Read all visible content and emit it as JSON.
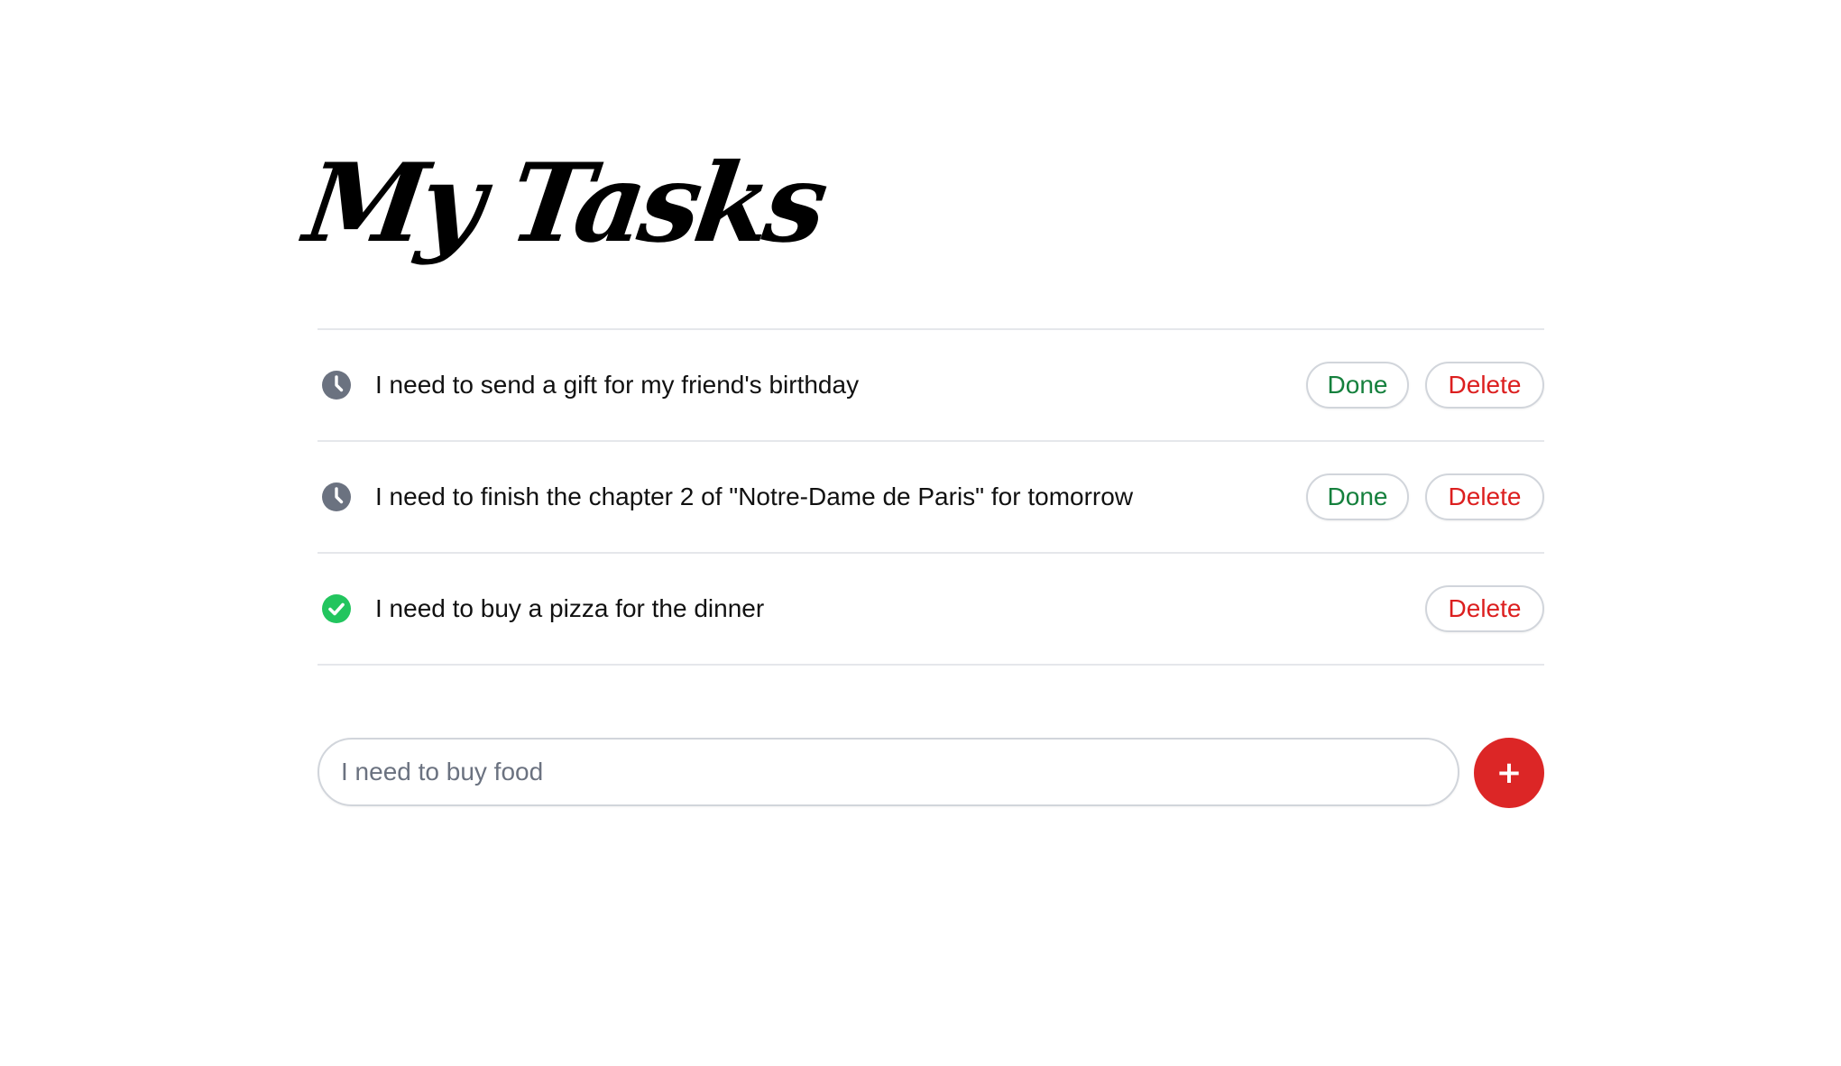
{
  "page": {
    "title": "My Tasks"
  },
  "tasks": [
    {
      "text": "I need to send a gift for my friend's birthday",
      "status": "pending",
      "status_icon": "clock-icon",
      "done_label": "Done",
      "delete_label": "Delete"
    },
    {
      "text": "I need to finish the chapter 2 of \"Notre-Dame de Paris\" for tomorrow",
      "status": "pending",
      "status_icon": "clock-icon",
      "done_label": "Done",
      "delete_label": "Delete"
    },
    {
      "text": "I need to buy a pizza for the dinner",
      "status": "completed",
      "status_icon": "check-circle-icon",
      "delete_label": "Delete"
    }
  ],
  "new_task": {
    "placeholder": "I need to buy food",
    "value": "",
    "add_label": "+"
  },
  "colors": {
    "done": "#15803d",
    "delete": "#dc1f1f",
    "add_button": "#dc2626",
    "pending_icon": "#6b7280",
    "completed_icon": "#22c55e",
    "divider": "#e5e7eb"
  }
}
